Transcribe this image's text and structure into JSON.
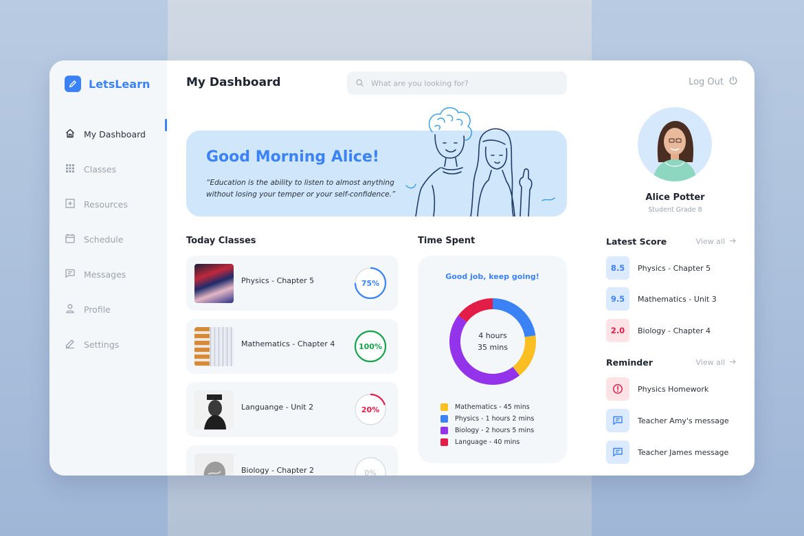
{
  "app": {
    "name": "LetsLearn"
  },
  "sidebar": {
    "items": [
      {
        "label": "My Dashboard",
        "icon": "home-icon",
        "active": true
      },
      {
        "label": "Classes",
        "icon": "grid-icon"
      },
      {
        "label": "Resources",
        "icon": "plus-square-icon"
      },
      {
        "label": "Schedule",
        "icon": "calendar-icon"
      },
      {
        "label": "Messages",
        "icon": "message-icon"
      },
      {
        "label": "Profile",
        "icon": "user-icon"
      },
      {
        "label": "Settings",
        "icon": "pencil-icon"
      }
    ]
  },
  "header": {
    "title": "My Dashboard",
    "search_placeholder": "What are you looking for?"
  },
  "hero": {
    "greeting": "Good Morning Alice!",
    "quote_line1": "“Education is the ability to listen to almost anything",
    "quote_line2": "without losing your temper or your self-confidence.”"
  },
  "today_classes": {
    "title": "Today Classes",
    "items": [
      {
        "name": "Physics - Chapter 5",
        "progress": 75,
        "progress_label": "75%",
        "color": "#3b82f6"
      },
      {
        "name": "Mathematics - Chapter 4",
        "progress": 100,
        "progress_label": "100%",
        "color": "#16a34a"
      },
      {
        "name": "Languange - Unit 2",
        "progress": 20,
        "progress_label": "20%",
        "color": "#e11d48"
      },
      {
        "name": "Biology - Chapter 2",
        "progress": 0,
        "progress_label": "0%",
        "color": "#b6bdc5"
      }
    ]
  },
  "time_spent": {
    "title": "Time Spent",
    "message": "Good job, keep going!",
    "total_line1": "4 hours",
    "total_line2": "35 mins",
    "legend": [
      {
        "label": "Mathematics - 45 mins",
        "color": "#fbbf24"
      },
      {
        "label": "Physics - 1 hours 2 mins",
        "color": "#3b82f6"
      },
      {
        "label": "Biology - 2 hours 5 mins",
        "color": "#9333ea"
      },
      {
        "label": "Language - 40 mins",
        "color": "#e11d48"
      }
    ]
  },
  "chart_data": {
    "type": "pie",
    "categories": [
      "Physics",
      "Mathematics",
      "Biology",
      "Language"
    ],
    "values": [
      62,
      45,
      125,
      40
    ],
    "colors": [
      "#3b82f6",
      "#fbbf24",
      "#9333ea",
      "#e11d48"
    ],
    "unit": "mins"
  },
  "right": {
    "logout_label": "Log Out",
    "user": {
      "name": "Alice Potter",
      "grade": "Student Grade 8"
    },
    "latest_score": {
      "title": "Latest Score",
      "view_all": "View all",
      "items": [
        {
          "score": "8.5",
          "subject": "Physics - Chapter 5",
          "bg": "#dbeafe",
          "fg": "#3b82f6"
        },
        {
          "score": "9.5",
          "subject": "Mathematics - Unit 3",
          "bg": "#dbeafe",
          "fg": "#3b82f6"
        },
        {
          "score": "2.0",
          "subject": "Biology - Chapter 4",
          "bg": "#fde2e6",
          "fg": "#e11d48"
        }
      ]
    },
    "reminder": {
      "title": "Reminder",
      "view_all": "View all",
      "items": [
        {
          "label": "Physics Homework",
          "icon": "alert-icon",
          "bg": "#fde2e6",
          "fg": "#e11d48"
        },
        {
          "label": "Teacher Amy's message",
          "icon": "chat-icon",
          "bg": "#dbeafe",
          "fg": "#3b82f6"
        },
        {
          "label": "Teacher James message",
          "icon": "chat-icon",
          "bg": "#dbeafe",
          "fg": "#3b82f6"
        }
      ]
    }
  }
}
